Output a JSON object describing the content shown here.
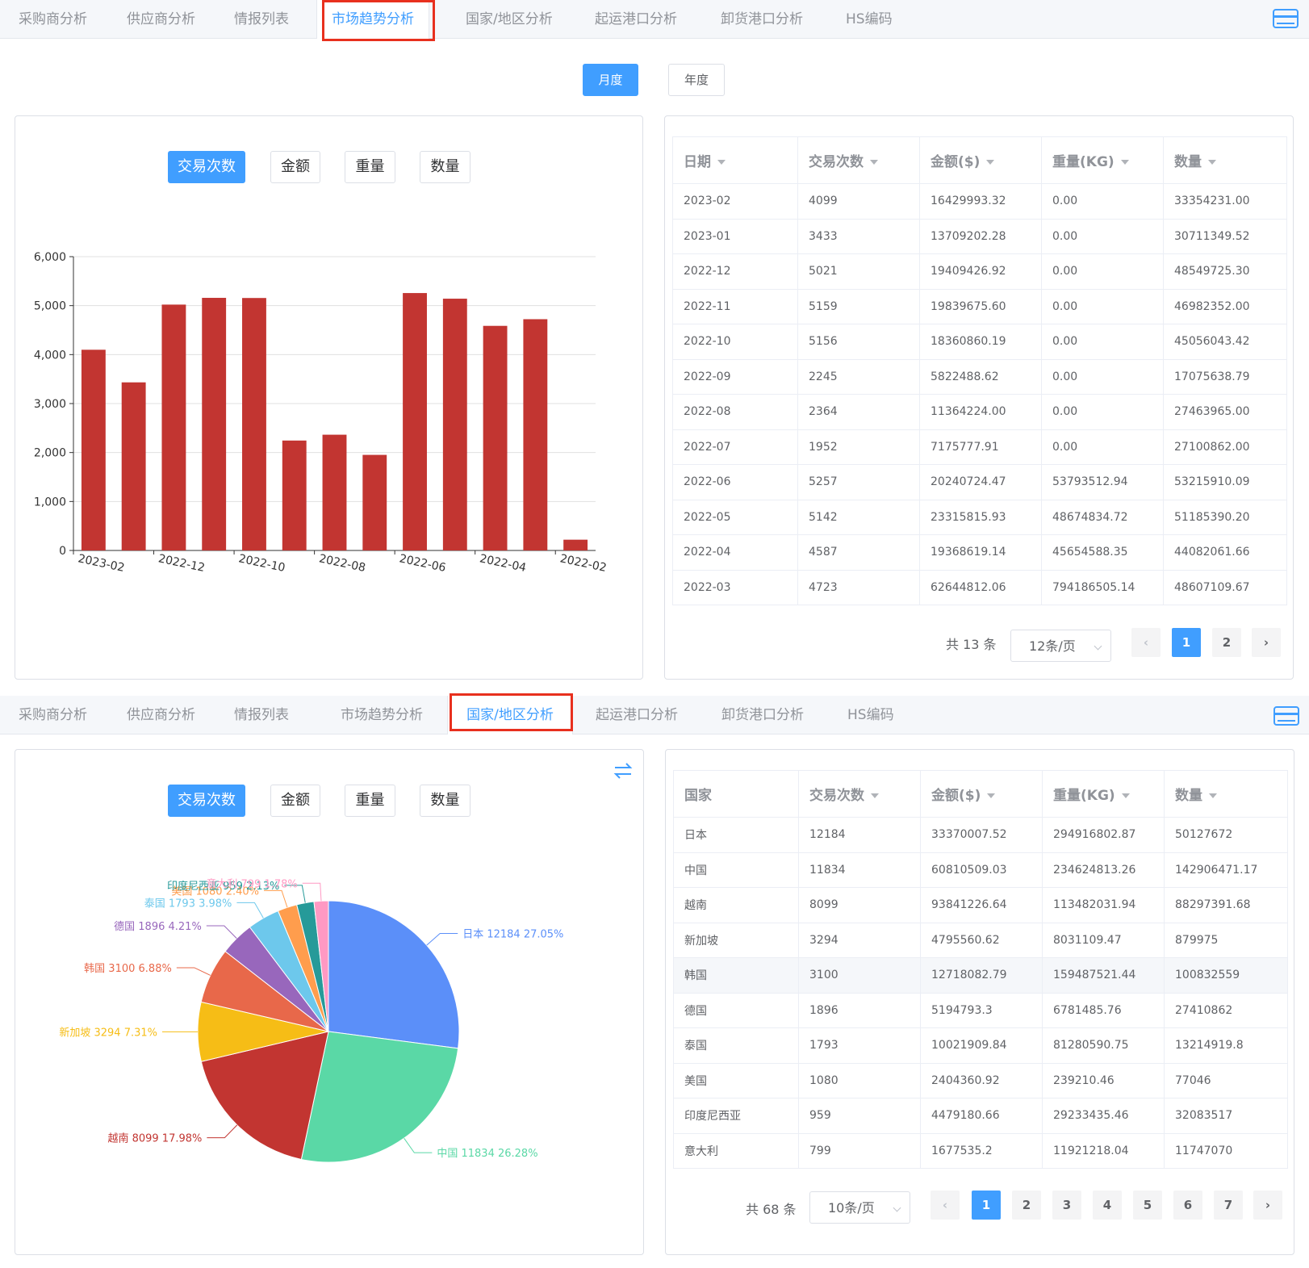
{
  "tabs": [
    "采购商分析",
    "供应商分析",
    "情报列表",
    "市场趋势分析",
    "国家/地区分析",
    "起运港口分析",
    "卸货港口分析",
    "HS编码"
  ],
  "period_toggle": {
    "monthly": "月度",
    "yearly": "年度"
  },
  "metric_buttons": [
    "交易次数",
    "金额",
    "重量",
    "数量"
  ],
  "trend_table": {
    "columns": [
      "日期",
      "交易次数",
      "金额($)",
      "重量(KG)",
      "数量"
    ],
    "rows": [
      [
        "2023-02",
        "4099",
        "16429993.32",
        "0.00",
        "33354231.00"
      ],
      [
        "2023-01",
        "3433",
        "13709202.28",
        "0.00",
        "30711349.52"
      ],
      [
        "2022-12",
        "5021",
        "19409426.92",
        "0.00",
        "48549725.30"
      ],
      [
        "2022-11",
        "5159",
        "19839675.60",
        "0.00",
        "46982352.00"
      ],
      [
        "2022-10",
        "5156",
        "18360860.19",
        "0.00",
        "45056043.42"
      ],
      [
        "2022-09",
        "2245",
        "5822488.62",
        "0.00",
        "17075638.79"
      ],
      [
        "2022-08",
        "2364",
        "11364224.00",
        "0.00",
        "27463965.00"
      ],
      [
        "2022-07",
        "1952",
        "7175777.91",
        "0.00",
        "27100862.00"
      ],
      [
        "2022-06",
        "5257",
        "20240724.47",
        "53793512.94",
        "53215910.09"
      ],
      [
        "2022-05",
        "5142",
        "23315815.93",
        "48674834.72",
        "51185390.20"
      ],
      [
        "2022-04",
        "4587",
        "19368619.14",
        "45654588.35",
        "44082061.66"
      ],
      [
        "2022-03",
        "4723",
        "62644812.06",
        "794186505.14",
        "48607109.67"
      ]
    ],
    "pagination": {
      "total": "共 13 条",
      "page_size": "12条/页",
      "pages": [
        "1",
        "2"
      ],
      "prev": "‹",
      "next": "›"
    }
  },
  "country_table": {
    "columns": [
      "国家",
      "交易次数",
      "金额($)",
      "重量(KG)",
      "数量"
    ],
    "rows": [
      [
        "日本",
        "12184",
        "33370007.52",
        "294916802.87",
        "50127672"
      ],
      [
        "中国",
        "11834",
        "60810509.03",
        "234624813.26",
        "142906471.17"
      ],
      [
        "越南",
        "8099",
        "93841226.64",
        "113482031.94",
        "88297391.68"
      ],
      [
        "新加坡",
        "3294",
        "4795560.62",
        "8031109.47",
        "879975"
      ],
      [
        "韩国",
        "3100",
        "12718082.79",
        "159487521.44",
        "100832559"
      ],
      [
        "德国",
        "1896",
        "5194793.3",
        "6781485.76",
        "27410862"
      ],
      [
        "泰国",
        "1793",
        "10021909.84",
        "81280590.75",
        "13214919.8"
      ],
      [
        "美国",
        "1080",
        "2404360.92",
        "239210.46",
        "77046"
      ],
      [
        "印度尼西亚",
        "959",
        "4479180.66",
        "29233435.46",
        "32083517"
      ],
      [
        "意大利",
        "799",
        "1677535.2",
        "11921218.04",
        "11747070"
      ]
    ],
    "pagination": {
      "total": "共 68 条",
      "page_size": "10条/页",
      "pages": [
        "1",
        "2",
        "3",
        "4",
        "5",
        "6",
        "7"
      ],
      "prev": "‹",
      "next": "›"
    }
  },
  "colors": {
    "accent": "#409eff",
    "bar": "#c23531",
    "highlight_box": "#e8301e"
  },
  "chart_data": [
    {
      "type": "bar",
      "categories": [
        "2023-02",
        "2023-01",
        "2022-12",
        "2022-11",
        "2022-10",
        "2022-09",
        "2022-08",
        "2022-07",
        "2022-06",
        "2022-05",
        "2022-04",
        "2022-03",
        "2022-02"
      ],
      "tick_labels": [
        "2023-02",
        "2022-12",
        "2022-10",
        "2022-08",
        "2022-06",
        "2022-04",
        "2022-02"
      ],
      "values": [
        4099,
        3433,
        5021,
        5159,
        5156,
        2245,
        2364,
        1952,
        5257,
        5142,
        4587,
        4723,
        220
      ],
      "ylim": [
        0,
        6000
      ],
      "yticks": [
        0,
        1000,
        2000,
        3000,
        4000,
        5000,
        6000
      ],
      "ytick_labels": [
        "0",
        "1,000",
        "2,000",
        "3,000",
        "4,000",
        "5,000",
        "6,000"
      ],
      "grid": true
    },
    {
      "type": "pie",
      "slices": [
        {
          "name": "日本",
          "value": 12184,
          "percent": "27.05%",
          "color": "#5b8ff9"
        },
        {
          "name": "中国",
          "value": 11834,
          "percent": "26.28%",
          "color": "#5ad8a6"
        },
        {
          "name": "越南",
          "value": 8099,
          "percent": "17.98%",
          "color": "#c23531"
        },
        {
          "name": "新加坡",
          "value": 3294,
          "percent": "7.31%",
          "color": "#f6bd16"
        },
        {
          "name": "韩国",
          "value": 3100,
          "percent": "6.88%",
          "color": "#e8684a"
        },
        {
          "name": "德国",
          "value": 1896,
          "percent": "4.21%",
          "color": "#9867bc"
        },
        {
          "name": "泰国",
          "value": 1793,
          "percent": "3.98%",
          "color": "#6dc8ec"
        },
        {
          "name": "美国",
          "value": 1080,
          "percent": "2.40%",
          "color": "#ff9d4d"
        },
        {
          "name": "印度尼西亚",
          "value": 959,
          "percent": "2.13%",
          "color": "#269a99"
        },
        {
          "name": "意大利",
          "value": 799,
          "percent": "1.78%",
          "color": "#ff99c3"
        }
      ]
    }
  ]
}
